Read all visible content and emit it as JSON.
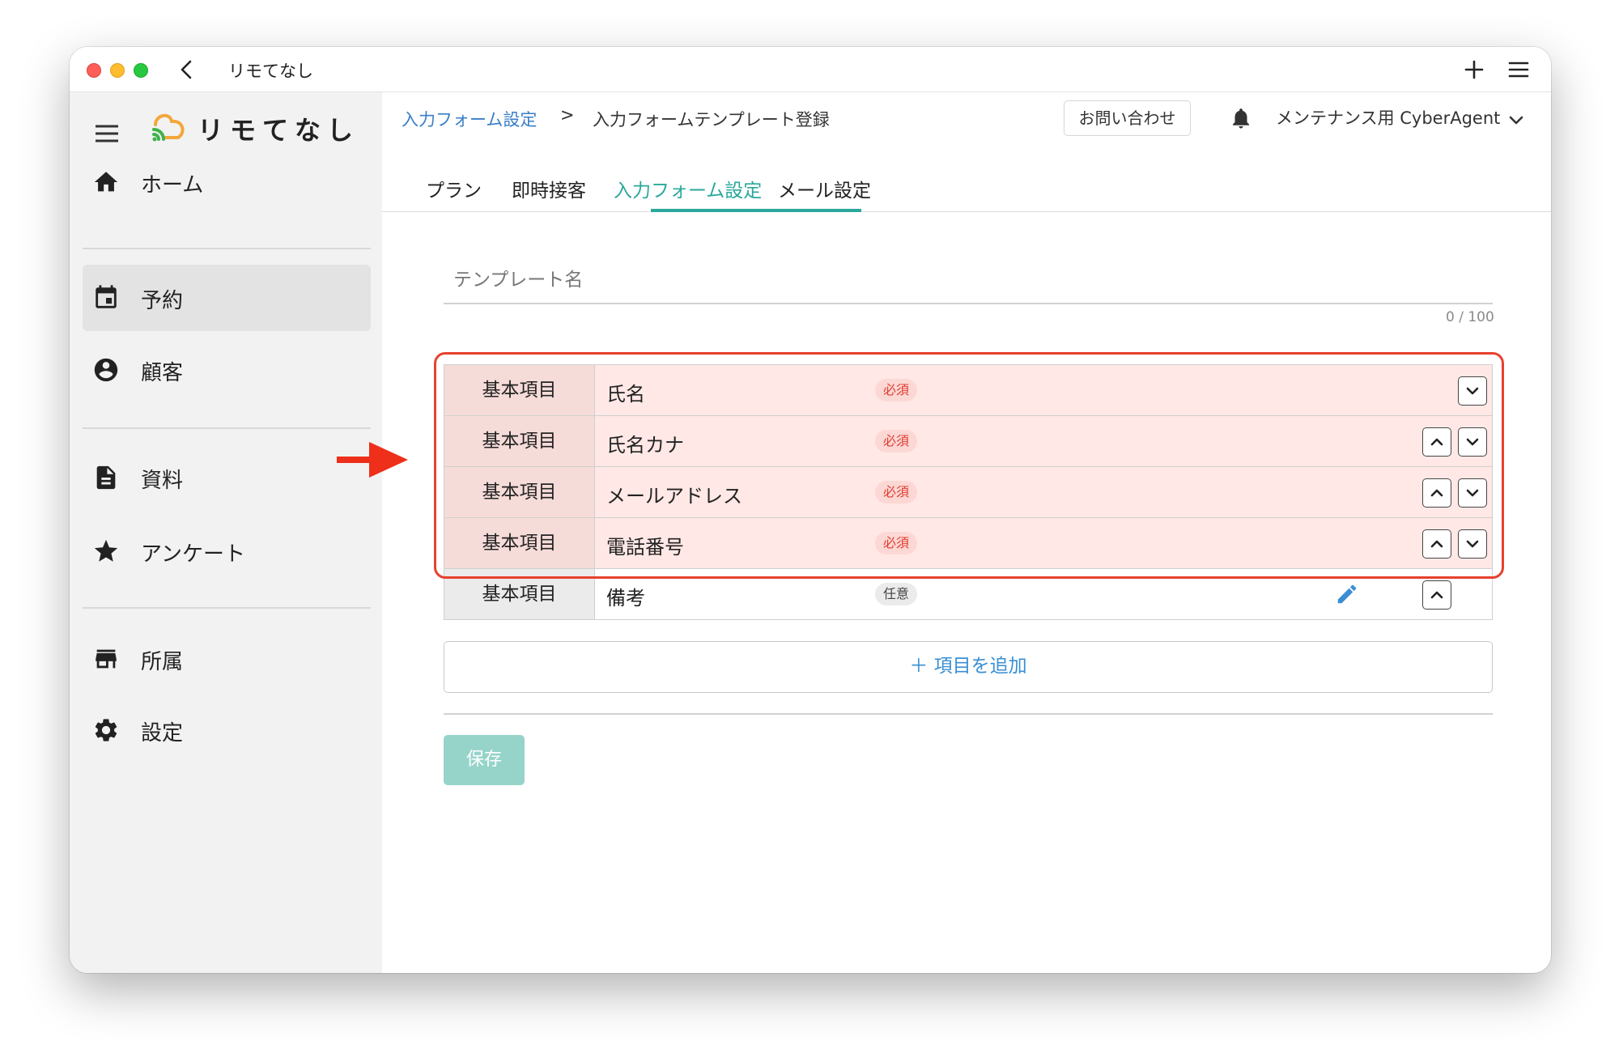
{
  "window": {
    "title": "リモてなし"
  },
  "sidebar": {
    "brand": "リモてなし",
    "items": [
      {
        "label": "ホーム",
        "icon": "home-icon",
        "active": false
      },
      {
        "label": "予約",
        "icon": "calendar-icon",
        "active": true
      },
      {
        "label": "顧客",
        "icon": "account-circle-icon",
        "active": false
      },
      {
        "label": "資料",
        "icon": "document-icon",
        "active": false
      },
      {
        "label": "アンケート",
        "icon": "star-icon",
        "active": false
      },
      {
        "label": "所属",
        "icon": "store-icon",
        "active": false
      },
      {
        "label": "設定",
        "icon": "gear-icon",
        "active": false
      }
    ]
  },
  "header": {
    "breadcrumb": {
      "parent": "入力フォーム設定",
      "separator": ">",
      "current": "入力フォームテンプレート登録"
    },
    "contact_label": "お問い合わせ",
    "user_name": "メンテナンス用 CyberAgent"
  },
  "tabs": [
    {
      "label": "プラン",
      "active": false
    },
    {
      "label": "即時接客",
      "active": false
    },
    {
      "label": "入力フォーム設定",
      "active": true
    },
    {
      "label": "メール設定",
      "active": false
    }
  ],
  "form": {
    "template_name_label": "テンプレート名",
    "template_name_value": "",
    "counter": "0 / 100",
    "fields": [
      {
        "category": "基本項目",
        "name": "氏名",
        "badge": "必須",
        "required": true
      },
      {
        "category": "基本項目",
        "name": "氏名カナ",
        "badge": "必須",
        "required": true
      },
      {
        "category": "基本項目",
        "name": "メールアドレス",
        "badge": "必須",
        "required": true
      },
      {
        "category": "基本項目",
        "name": "電話番号",
        "badge": "必須",
        "required": true
      },
      {
        "category": "基本項目",
        "name": "備考",
        "badge": "任意",
        "required": false
      }
    ],
    "add_label": "＋ 項目を追加",
    "save_label": "保存"
  },
  "colors": {
    "accent": "#2aa89b",
    "link": "#3a7ec6",
    "highlight_border": "#e8402e",
    "required_text": "#e03c31"
  }
}
